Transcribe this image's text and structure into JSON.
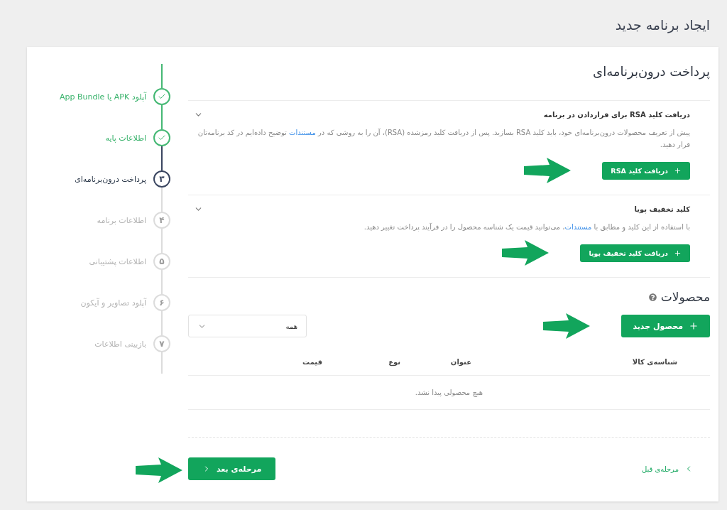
{
  "page_title": "ایجاد برنامه جدید",
  "steps": [
    {
      "label": "آپلود APK یا App Bundle",
      "done": true,
      "current": false
    },
    {
      "label": "اطلاعات پایه",
      "done": true,
      "current": false
    },
    {
      "label": "پرداخت درون‌برنامه‌ای",
      "done": false,
      "current": true,
      "number": "۳"
    },
    {
      "label": "اطلاعات برنامه",
      "done": false,
      "current": false,
      "number": "۴"
    },
    {
      "label": "اطلاعات پشتیبانی",
      "done": false,
      "current": false,
      "number": "۵"
    },
    {
      "label": "آپلود تصاویر و آیکون",
      "done": false,
      "current": false,
      "number": "۶"
    },
    {
      "label": "بازبینی اطلاعات",
      "done": false,
      "current": false,
      "number": "۷"
    }
  ],
  "heading": "پرداخت درون‌برنامه‌ای",
  "sections": [
    {
      "title": "دریافت کلید RSA برای قراردادن در برنامه",
      "expanded": true,
      "description": {
        "before": "پیش از تعریف محصولات درون‌برنامه‌ای خود، باید کلید RSA بسازید. پس از دریافت کلید رمزشده (RSA)، آن را به روشی که در ",
        "link": "مستندات",
        "after": " توضیح داده‌ایم در کد برنامه‌تان قرار دهید."
      },
      "button": "دریافت کلید RSA"
    },
    {
      "title": "کلید تخفیف پویا",
      "expanded": true,
      "description": {
        "before": "با استفاده از این کلید و مطابق با ",
        "link": "مستندات",
        "after": "، می‌توانید قیمت یک شناسه محصول را در فرآیند پرداخت تغییر دهید."
      },
      "button": "دریافت کلید تخفیف پویا"
    }
  ],
  "products": {
    "title": "محصولات",
    "new_button": "محصول جدید",
    "filter": {
      "value": "همه"
    },
    "table": {
      "columns": [
        "شناسه‌ی کالا",
        "عنوان",
        "نوع",
        "قیمت"
      ],
      "empty_message": "هیچ محصولی پیدا نشد."
    }
  },
  "footer": {
    "next_button": "مرحله‌ی بعد",
    "previous_link": "مرحله‌ی قبل"
  }
}
